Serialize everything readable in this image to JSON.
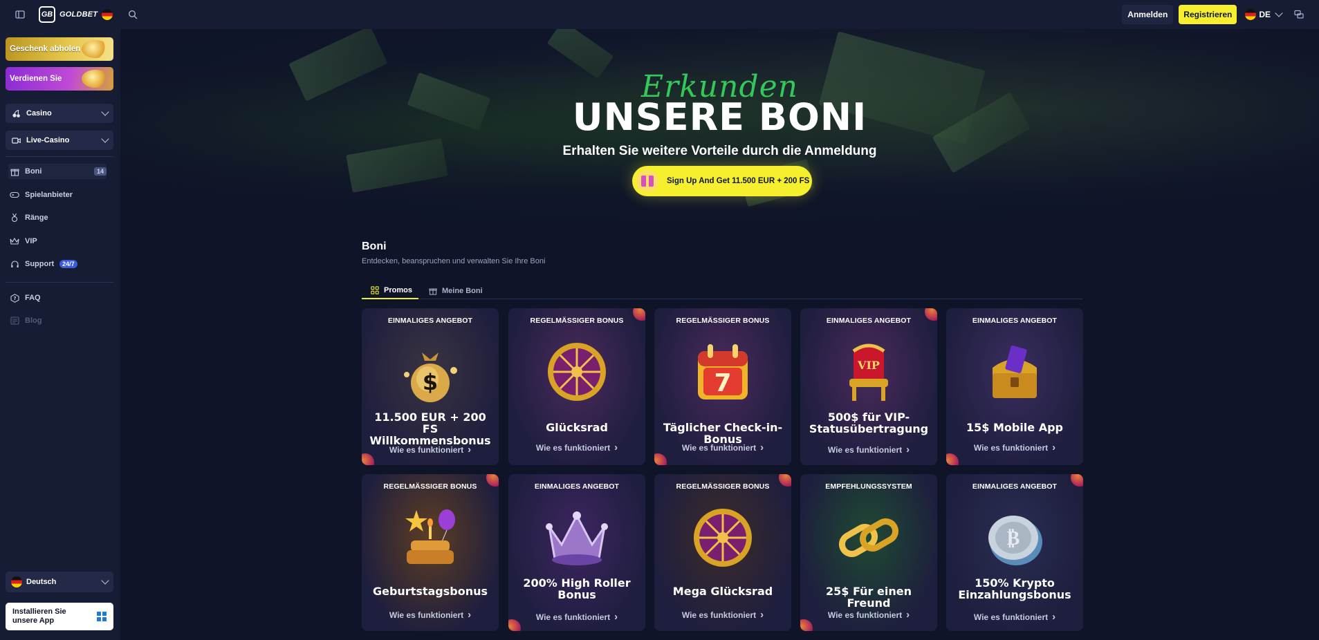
{
  "topbar": {
    "brand": "GOLDBET",
    "logo_mark": "GB",
    "login_label": "Anmelden",
    "register_label": "Registrieren",
    "language_code": "DE"
  },
  "sidebar": {
    "gift_label": "Geschenk abholen",
    "earn_label": "Verdienen Sie",
    "casino_label": "Casino",
    "live_casino_label": "Live-Casino",
    "items": [
      {
        "label": "Boni",
        "icon": "gift-icon",
        "badge": "14"
      },
      {
        "label": "Spielanbieter",
        "icon": "gamepad-icon"
      },
      {
        "label": "Ränge",
        "icon": "medal-icon"
      },
      {
        "label": "VIP",
        "icon": "crown-icon"
      },
      {
        "label": "Support",
        "icon": "headset-icon",
        "badge": "24/7"
      },
      {
        "label": "FAQ",
        "icon": "question-icon"
      },
      {
        "label": "Blog",
        "icon": "blog-icon"
      }
    ],
    "language_label": "Deutsch",
    "install_label": "Installieren Sie unsere App"
  },
  "hero": {
    "script_text": "Erkunden",
    "title": "UNSERE BONI",
    "subtitle": "Erhalten Sie weitere Vorteile durch die Anmeldung",
    "cta_label": "Sign Up And Get 11.500 EUR + 200 FS"
  },
  "section": {
    "title": "Boni",
    "subtitle": "Entdecken, beanspruchen und verwalten Sie Ihre Boni",
    "tabs": [
      {
        "label": "Promos",
        "active": true
      },
      {
        "label": "Meine Boni",
        "active": false
      }
    ]
  },
  "how_label": "Wie es funktioniert",
  "cards": [
    {
      "tag": "EINMALIGES ANGEBOT",
      "title": "11.500 EUR + 200 FS Willkommensbonus",
      "art": "money-bag-icon",
      "bg": "#3a3340"
    },
    {
      "tag": "REGELMÄSSIGER BONUS",
      "title": "Glücksrad",
      "art": "wheel-icon",
      "bg": "#4a2a5c"
    },
    {
      "tag": "REGELMÄSSIGER BONUS",
      "title": "Täglicher Check-in-Bonus",
      "art": "calendar-icon",
      "bg": "#4a2a5c"
    },
    {
      "tag": "EINMALIGES ANGEBOT",
      "title": "500$ für VIP-Statusübertragung",
      "art": "vip-throne-icon",
      "bg": "#4a2a5c"
    },
    {
      "tag": "EINMALIGES ANGEBOT",
      "title": "15$ Mobile App",
      "art": "treasure-chest-icon",
      "bg": "#3a2e5e"
    },
    {
      "tag": "REGELMÄSSIGER BONUS",
      "title": "Geburtstagsbonus",
      "art": "cake-icon",
      "bg": "#5e3e22"
    },
    {
      "tag": "EINMALIGES ANGEBOT",
      "title": "200% High Roller Bonus",
      "art": "crown-icon",
      "bg": "#3e2560"
    },
    {
      "tag": "REGELMÄSSIGER BONUS",
      "title": "Mega Glücksrad",
      "art": "wheel-icon",
      "bg": "#3d2c2a"
    },
    {
      "tag": "EMPFEHLUNGSSYSTEM",
      "title": "25$ Für einen Freund",
      "art": "chain-link-icon",
      "bg": "#1f4a32"
    },
    {
      "tag": "EINMALIGES ANGEBOT",
      "title": "150% Krypto Einzahlungsbonus",
      "art": "crypto-coin-icon",
      "bg": "#2a2e52"
    }
  ]
}
